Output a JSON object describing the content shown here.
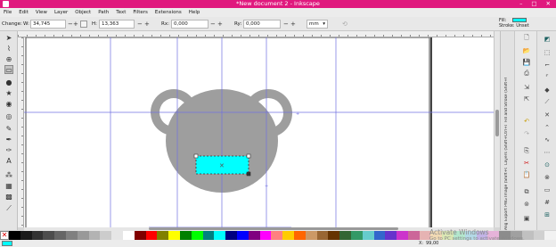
{
  "window": {
    "title": "*New document 2 - Inkscape",
    "minimize_glyph": "–",
    "maximize_glyph": "□",
    "close_glyph": "✕"
  },
  "menubar": {
    "items": [
      "File",
      "Edit",
      "View",
      "Layer",
      "Object",
      "Path",
      "Text",
      "Filters",
      "Extensions",
      "Help"
    ]
  },
  "controls": {
    "change_label": "Change:",
    "w_label": "W:",
    "w_value": "34,745",
    "h_label": "H:",
    "h_value": "13,363",
    "rx_label": "Rx:",
    "rx_value": "0,000",
    "ry_label": "Ry:",
    "ry_value": "0,000",
    "units": "mm",
    "fill_label": "Fill:",
    "stroke_label": "Stroke:",
    "stroke_value": "Unset",
    "fill_color": "#00ffff"
  },
  "toolbox": {
    "tools": [
      {
        "name": "selector-tool-icon",
        "glyph": "➤"
      },
      {
        "name": "node-tool-icon",
        "glyph": "⌇"
      },
      {
        "name": "zoom-tool-icon",
        "glyph": "⊕"
      },
      {
        "name": "rect-tool-icon",
        "glyph": "▭",
        "active": true
      },
      {
        "name": "ellipse-tool-icon",
        "glyph": "●"
      },
      {
        "name": "star-tool-icon",
        "glyph": "★"
      },
      {
        "name": "3dbox-tool-icon",
        "glyph": "◉"
      },
      {
        "name": "spiral-tool-icon",
        "glyph": "◎"
      },
      {
        "name": "pencil-tool-icon",
        "glyph": "✎"
      },
      {
        "name": "pen-tool-icon",
        "glyph": "✒"
      },
      {
        "name": "calligraphy-tool-icon",
        "glyph": "✑"
      },
      {
        "name": "text-tool-icon",
        "glyph": "A"
      },
      {
        "name": "spray-tool-icon",
        "glyph": "⁂"
      },
      {
        "name": "gradient-tool-icon",
        "glyph": "▦"
      },
      {
        "name": "mesh-tool-icon",
        "glyph": "▩"
      },
      {
        "name": "dropper-tool-icon",
        "glyph": "⟋"
      }
    ]
  },
  "canvas": {
    "head_color": "#9e9e9e",
    "selected_rect_color": "#00ffff",
    "guide_color": "#6a6ad8"
  },
  "dock_tabs": [
    "Fill and Stroke (Shift+Ctrl+F)",
    "Layers (Shift+Ctrl+L)",
    "Export PNG Image (Shift+Ctrl+E)",
    "Align..."
  ],
  "palette": {
    "none_glyph": "✕",
    "colors": [
      "#000000",
      "#1a1a1a",
      "#333333",
      "#4d4d4d",
      "#666666",
      "#808080",
      "#999999",
      "#b3b3b3",
      "#cccccc",
      "#e6e6e6",
      "#ffffff",
      "#800000",
      "#ff0000",
      "#808000",
      "#ffff00",
      "#008000",
      "#00ff00",
      "#008080",
      "#00ffff",
      "#000080",
      "#0000ff",
      "#800080",
      "#ff00ff",
      "#ff8080",
      "#ffcc00",
      "#ff6600",
      "#cc9966",
      "#996633",
      "#663300",
      "#336633",
      "#339966",
      "#66cccc",
      "#3366cc",
      "#6633cc",
      "#cc33cc",
      "#cc6699",
      "#e6b3b3",
      "#f0d9b3",
      "#d9e6b3",
      "#b3e6cc",
      "#b3d9e6",
      "#c2b3e6",
      "#e6b3d9",
      "#8c8c8c",
      "#a0a0a0",
      "#c0c0c0",
      "#d0d0d0",
      "#f2f2f2"
    ]
  },
  "watermark": {
    "line1": "Activate Windows",
    "line2": "Go to PC settings to activate Windows."
  },
  "status": {
    "x_label": "X:",
    "y_label": "Y:",
    "x_value": "99,00"
  }
}
